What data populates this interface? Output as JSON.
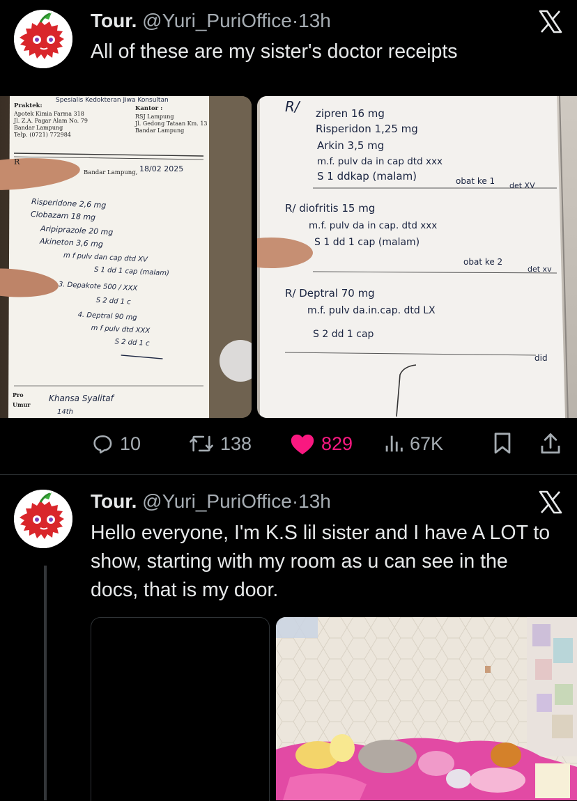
{
  "tweets": [
    {
      "display_name": "Tour.",
      "handle": "@Yuri_PuriOffice",
      "separator": "·",
      "time": "13h",
      "text": "All of these are my sister's doctor receipts",
      "actions": {
        "replies": "10",
        "retweets": "138",
        "likes": "829",
        "views": "67K"
      },
      "icons": [
        "x-logo-icon",
        "reply-icon",
        "retweet-icon",
        "heart-icon",
        "views-icon",
        "bookmark-icon",
        "share-icon"
      ],
      "receipt_left": {
        "header_center": "Spesialis Kedokteran Jiwa Konsultan",
        "praktek_label": "Praktek:",
        "praktek_lines": [
          "Apotek Kimia Farma 318",
          "Jl. Z.A. Pagar Alam No. 79",
          "Bandar Lampung",
          "Telp. (0721) 772984"
        ],
        "kantor_label": "Kantor :",
        "kantor_lines": [
          "RSJ Lampung",
          "Jl. Gedong Tataan Km. 13",
          "Bandar Lampung"
        ],
        "city": "Bandar Lampung,",
        "date": "18/02 2025",
        "rx": "R",
        "lines": [
          "Risperidone 2,6 mg",
          "Clobazam 18 mg",
          "Aripiprazole 20 mg",
          "Akineton 3,6 mg",
          "m f pulv dan cap dtd XV",
          "S 1 dd 1 cap (malam)",
          "3. Depakote 500 / XXX",
          "S 2 dd 1 c",
          "4. Deptral 90 mg",
          "m f pulv dtd XXX",
          "S 2 dd 1 c"
        ],
        "patient_label": "Pro",
        "age_label": "Umur",
        "patient_name": "Khansa Syalitaf",
        "age": "14th"
      },
      "receipt_right": {
        "rx": "R/",
        "lines": [
          "zipren 16 mg",
          "Risperidon 1,25 mg",
          "Arkin 3,5 mg",
          "m.f. pulv da in cap dtd xxx",
          "S 1 ddkap (malam)",
          "obat ke 1",
          "det XV",
          "R/ diofritis 15 mg",
          "m.f. pulv da in cap. dtd xxx",
          "S 1 dd 1 cap (malam)",
          "obat ke 2",
          "det xv",
          "R/ Deptral 70 mg",
          "m.f. pulv da.in.cap. dtd LX",
          "S 2 dd 1 cap",
          "did"
        ]
      }
    },
    {
      "display_name": "Tour.",
      "handle": "@Yuri_PuriOffice",
      "separator": "·",
      "time": "13h",
      "text": "Hello everyone, I'm K.S lil sister and I have A LOT to show, starting with my room as u can see in the docs, that is my door.",
      "icons": [
        "x-logo-icon"
      ]
    }
  ],
  "colors": {
    "background": "#000000",
    "text": "#e7e9ea",
    "secondary": "#a6adb3",
    "like": "#f91880",
    "divider": "#2f3336"
  }
}
